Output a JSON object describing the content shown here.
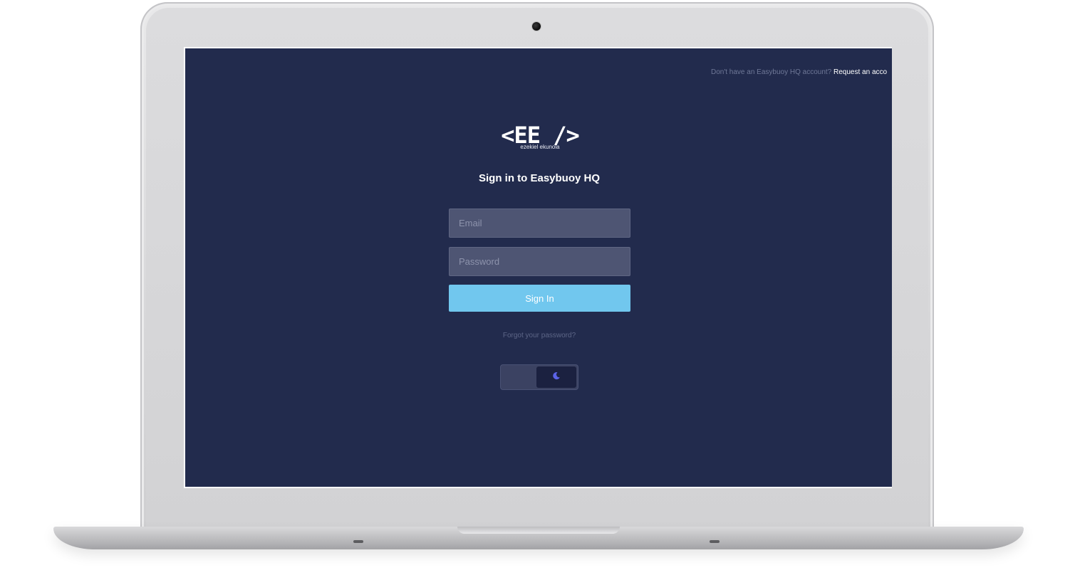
{
  "topbar": {
    "prompt": "Don't have an Easybuoy HQ account?",
    "link": "Request an acco"
  },
  "logo": {
    "mark": "<EE />",
    "subtitle": "ezekiel ekunola"
  },
  "heading": "Sign in to Easybuoy HQ",
  "form": {
    "email_placeholder": "Email",
    "password_placeholder": "Password",
    "signin_label": "Sign In",
    "forgot_label": "Forgot your password?"
  },
  "theme_toggle": {
    "state": "dark",
    "icon": "moon-icon"
  },
  "colors": {
    "background": "#222b4d",
    "field": "#4e5573",
    "button": "#71c7ee",
    "moon": "#5b63e8"
  }
}
